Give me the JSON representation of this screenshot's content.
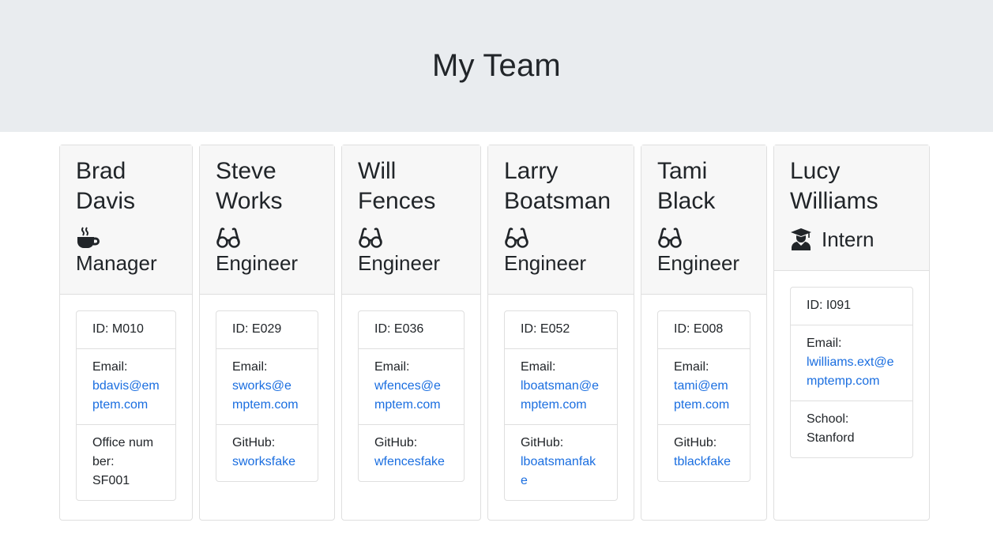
{
  "page": {
    "title": "My Team"
  },
  "team": [
    {
      "first": "Brad",
      "last": "Davis",
      "role": "Manager",
      "icon": "coffee-icon",
      "id_text": "ID: M010",
      "email_label": "Email:",
      "email": "bdavis@emptem.com",
      "extra_label": "Office number:",
      "extra_value": "SF001",
      "extra_is_link": false
    },
    {
      "first": "Steve",
      "last": "Works",
      "role": "Engineer",
      "icon": "glasses-icon",
      "id_text": "ID: E029",
      "email_label": "Email:",
      "email": "sworks@emptem.com",
      "extra_label": "GitHub:",
      "extra_value": "sworksfake",
      "extra_is_link": true
    },
    {
      "first": "Will",
      "last": "Fences",
      "role": "Engineer",
      "icon": "glasses-icon",
      "id_text": "ID: E036",
      "email_label": "Email:",
      "email": "wfences@emptem.com",
      "extra_label": "GitHub:",
      "extra_value": "wfencesfake",
      "extra_is_link": true
    },
    {
      "first": "Larry",
      "last": "Boatsman",
      "role": "Engineer",
      "icon": "glasses-icon",
      "id_text": "ID: E052",
      "email_label": "Email:",
      "email": "lboatsman@emptem.com",
      "extra_label": "GitHub:",
      "extra_value": "lboatsmanfake",
      "extra_is_link": true
    },
    {
      "first": "Tami",
      "last": "Black",
      "role": "Engineer",
      "icon": "glasses-icon",
      "id_text": "ID: E008",
      "email_label": "Email:",
      "email": "tami@emptem.com",
      "extra_label": "GitHub:",
      "extra_value": "tblackfake",
      "extra_is_link": true
    },
    {
      "first": "Lucy",
      "last": "Williams",
      "role": "Intern",
      "icon": "graduate-icon",
      "id_text": "ID: I091",
      "email_label": "Email:",
      "email": "lwilliams.ext@emptemp.com",
      "extra_label": "School:",
      "extra_value": "Stanford",
      "extra_is_link": false
    }
  ]
}
